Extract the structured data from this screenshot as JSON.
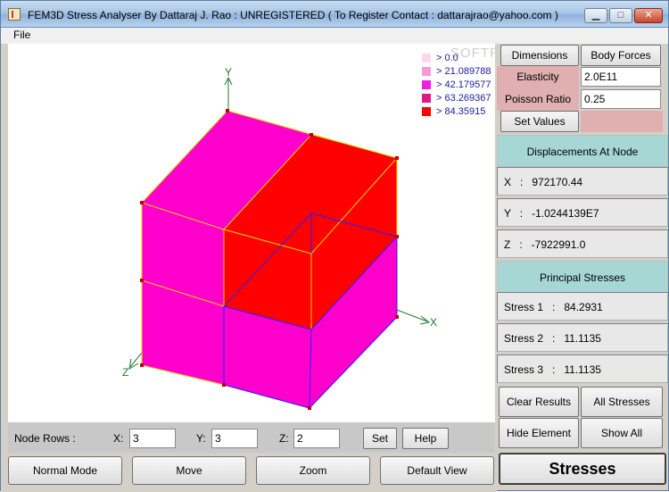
{
  "window": {
    "title": "FEM3D Stress Analyser By Dattaraj J. Rao : UNREGISTERED ( To Register Contact : dattarajrao@yahoo.com )",
    "controls": {
      "minimize": "▁",
      "maximize": "□",
      "close": "✕"
    }
  },
  "menu": {
    "file": "File"
  },
  "watermark": "SOFTPEDIA",
  "legend": {
    "items": [
      {
        "label": "> 0.0",
        "color": "#fcd7f0"
      },
      {
        "label": "> 21.089788",
        "color": "#f59bd8"
      },
      {
        "label": "> 42.179577",
        "color": "#ee1ee6"
      },
      {
        "label": "> 63.269367",
        "color": "#e01884"
      },
      {
        "label": "> 84.35915",
        "color": "#ff0000"
      }
    ]
  },
  "axes": {
    "x": "X",
    "y": "Y",
    "z": "Z"
  },
  "panel": {
    "dimensions": "Dimensions",
    "body_forces": "Body Forces",
    "elasticity_label": "Elasticity",
    "elasticity_value": "2.0E11",
    "poisson_label": "Poisson Ratio",
    "poisson_value": "0.25",
    "set_values": "Set Values",
    "displacements_header": "Displacements At Node",
    "disp_x": "X   :   972170.44",
    "disp_y": "Y   :   -1.0244139E7",
    "disp_z": "Z   :   -7922991.0",
    "principal_header": "Principal Stresses",
    "stress1": "Stress 1   :   84.2931",
    "stress2": "Stress 2   :   11.1135",
    "stress3": "Stress 3   :   11.1135",
    "clear_results": "Clear Results",
    "all_stresses": "All Stresses",
    "hide_element": "Hide Element",
    "show_all": "Show All",
    "stresses": "Stresses"
  },
  "node_rows": {
    "label": "Node Rows  :",
    "x_label": "X:",
    "x_value": "3",
    "y_label": "Y:",
    "y_value": "3",
    "z_label": "Z:",
    "z_value": "2",
    "set": "Set",
    "help": "Help"
  },
  "modes": {
    "normal": "Normal Mode",
    "move": "Move",
    "zoom": "Zoom",
    "default_view": "Default View"
  },
  "colors": {
    "magenta": "#ff00cc",
    "red": "#ff0000",
    "outline_yellow": "#e8d800",
    "outline_blue": "#2222ff",
    "axis_green": "#1e7a2e",
    "teal_header": "#a6d7d5",
    "pink_label": "#e0b0b0"
  }
}
